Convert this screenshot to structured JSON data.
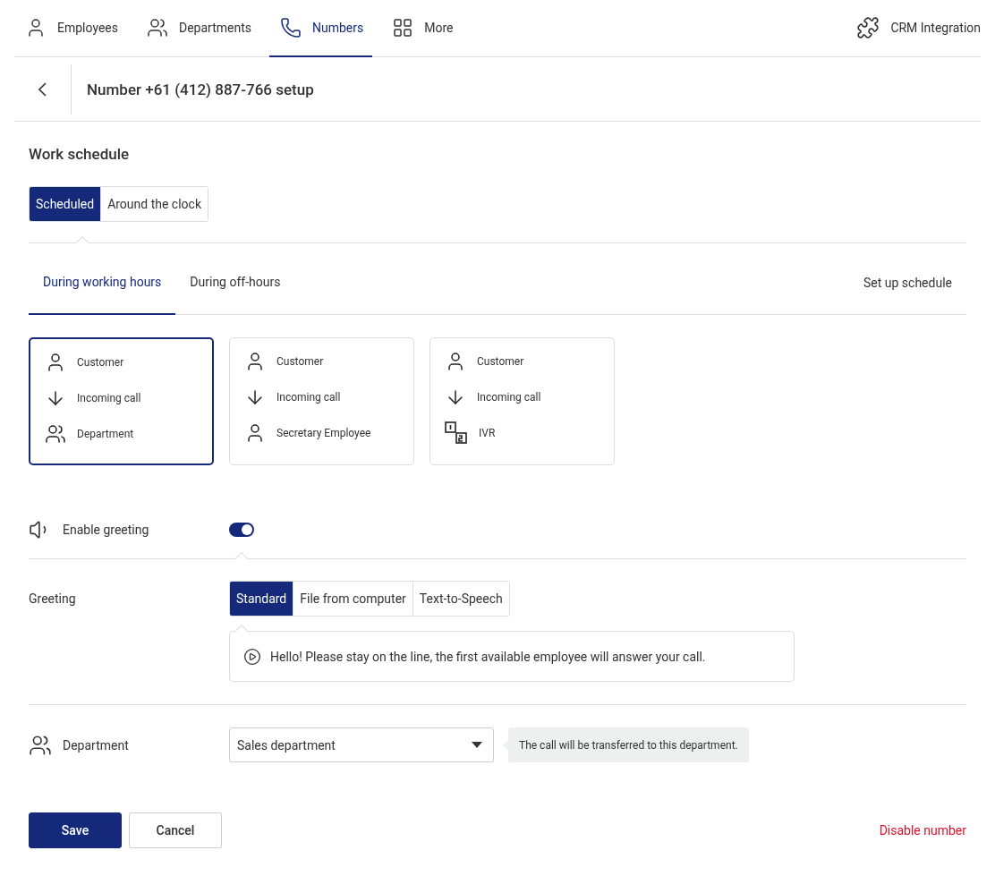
{
  "nav": {
    "tabs": [
      {
        "label": "Employees",
        "selected": false
      },
      {
        "label": "Departments",
        "selected": false
      },
      {
        "label": "Numbers",
        "selected": true
      },
      {
        "label": "More",
        "selected": false
      }
    ],
    "integration": "CRM Integration"
  },
  "header": {
    "title": "Number +61 (412) 887-766 setup"
  },
  "schedule": {
    "title": "Work schedule",
    "modes": [
      {
        "label": "Scheduled",
        "selected": true
      },
      {
        "label": "Around the clock",
        "selected": false
      }
    ]
  },
  "hours_tabs": [
    {
      "label": "During working hours",
      "selected": true
    },
    {
      "label": "During off-hours",
      "selected": false
    }
  ],
  "setup_link": "Set up schedule",
  "cards": [
    {
      "selected": true,
      "steps": [
        {
          "kind": "customer",
          "label": "Customer"
        },
        {
          "kind": "call",
          "label": "Incoming call"
        },
        {
          "kind": "department",
          "label": "Department"
        }
      ]
    },
    {
      "selected": false,
      "steps": [
        {
          "kind": "customer",
          "label": "Customer"
        },
        {
          "kind": "call",
          "label": "Incoming call"
        },
        {
          "kind": "employee",
          "label": "Secretary Employee"
        }
      ]
    },
    {
      "selected": false,
      "steps": [
        {
          "kind": "customer",
          "label": "Customer"
        },
        {
          "kind": "call",
          "label": "Incoming call"
        },
        {
          "kind": "ivr",
          "label": "IVR"
        }
      ]
    }
  ],
  "greeting_toggle": {
    "label": "Enable greeting",
    "on": true
  },
  "greeting": {
    "label": "Greeting",
    "options": [
      {
        "label": "Standard",
        "selected": true
      },
      {
        "label": "File from computer",
        "selected": false
      },
      {
        "label": "Text-to-Speech",
        "selected": false
      }
    ],
    "message": "Hello! Please stay on the line, the first available employee will answer your call."
  },
  "department": {
    "label": "Department",
    "value": "Sales department",
    "hint": "The call will be transferred to this department."
  },
  "actions": {
    "save": "Save",
    "cancel": "Cancel",
    "disable": "Disable number"
  }
}
